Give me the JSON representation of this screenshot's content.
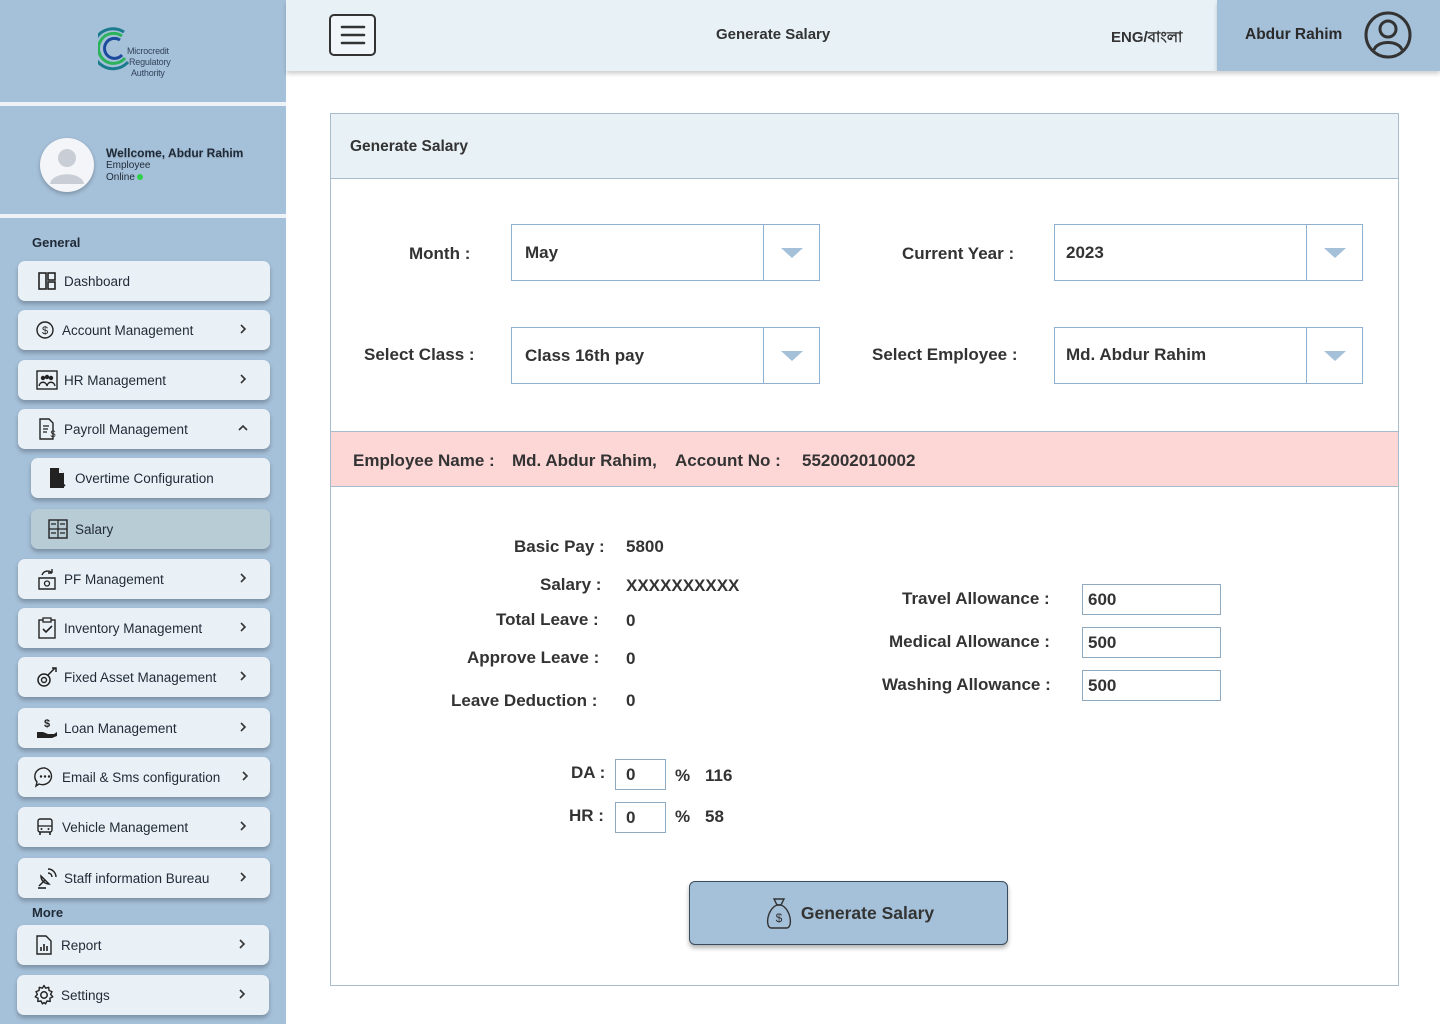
{
  "sidebar": {
    "logo_lines": [
      "Microcredit",
      "Regulatory",
      "Authority"
    ],
    "user": {
      "welcome": "Wellcome, Abdur Rahim",
      "role": "Employee",
      "status": "Online"
    },
    "section_general": "General",
    "section_more": "More",
    "items": [
      {
        "label": "Dashboard",
        "icon": "dashboard-icon"
      },
      {
        "label": "Account Management",
        "icon": "dollar-icon"
      },
      {
        "label": "HR Management",
        "icon": "people-icon"
      },
      {
        "label": "Payroll Management",
        "icon": "payroll-icon"
      },
      {
        "label": "Overtime Configuration",
        "icon": "document-icon"
      },
      {
        "label": "Salary",
        "icon": "table-icon"
      },
      {
        "label": "PF Management",
        "icon": "fund-icon"
      },
      {
        "label": "Inventory Management",
        "icon": "clipboard-check-icon"
      },
      {
        "label": "Fixed Asset Management",
        "icon": "asset-icon"
      },
      {
        "label": "Loan Management",
        "icon": "loan-icon"
      },
      {
        "label": "Email & Sms configuration",
        "icon": "chat-icon"
      },
      {
        "label": "Vehicle Management",
        "icon": "bus-icon"
      },
      {
        "label": "Staff information Bureau",
        "icon": "satellite-icon"
      },
      {
        "label": "Report",
        "icon": "report-icon"
      },
      {
        "label": "Settings",
        "icon": "gear-icon"
      }
    ]
  },
  "topbar": {
    "title": "Generate Salary",
    "language": "ENG/বাংলা",
    "user_name": "Abdur Rahim"
  },
  "panel": {
    "title": "Generate Salary",
    "month_label": "Month :",
    "month_value": "May",
    "year_label": "Current Year :",
    "year_value": "2023",
    "class_label": "Select Class :",
    "class_value": "Class 16th pay",
    "employee_label": "Select Employee :",
    "employee_value": "Md. Abdur Rahim"
  },
  "employee_bar": {
    "name_label": "Employee Name :",
    "name_value": "Md. Abdur Rahim,",
    "account_label": "Account No :",
    "account_value": "552002010002"
  },
  "details": {
    "basic_pay_label": "Basic Pay :",
    "basic_pay": "5800",
    "salary_label": "Salary :",
    "salary": "XXXXXXXXXX",
    "total_leave_label": "Total Leave :",
    "total_leave": "0",
    "approve_leave_label": "Approve Leave :",
    "approve_leave": "0",
    "leave_deduction_label": "Leave Deduction :",
    "leave_deduction": "0",
    "travel_label": "Travel Allowance :",
    "travel": "600",
    "medical_label": "Medical Allowance :",
    "medical": "500",
    "washing_label": "Washing Allowance :",
    "washing": "500",
    "da_label": "DA :",
    "da_percent": "0",
    "da_amount": "116",
    "hr_label": "HR :",
    "hr_percent": "0",
    "hr_amount": "58",
    "percent_sign": "%"
  },
  "generate_button": "Generate Salary"
}
